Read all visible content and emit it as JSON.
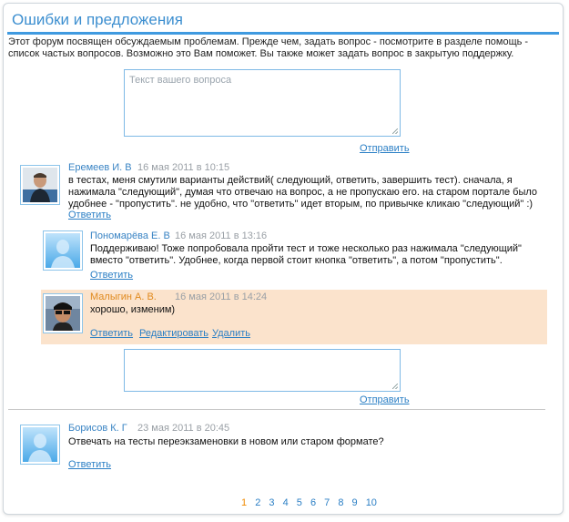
{
  "header": {
    "title": "Ошибки и предложения"
  },
  "intro": "Этот форум посвящен обсуждаемым проблемам. Прежде чем, задать вопрос - посмотрите в разделе помощь - список частых вопросов. Возможно это Вам поможет. Вы также может задать вопрос в закрытую поддержку.",
  "question_box": {
    "placeholder": "Текст вашего вопроса",
    "send_label": "Отправить"
  },
  "threads": [
    {
      "author": "Еремеев И. В",
      "date": "16 мая 2011 в 10:15",
      "text": "в тестах, меня смутили варианты действий( следующий, ответить, завершить тест). сначала, я нажимала \"следующий\", думая что отвечаю на вопрос, а не пропускаю его. на старом портале было удобнее - \"пропустить\". не удобно, что \"ответить\" идет вторым, по привычке кликаю \"следующий\" :)",
      "reply_label": "Ответить",
      "replies": [
        {
          "author": "Пономарёва Е. В",
          "date": "16 мая 2011 в 13:16",
          "text": "Поддерживаю! Тоже попробовала пройти тест и тоже несколько раз нажимала \"следующий\" вместо \"ответить\". Удобнее, когда первой стоит кнопка \"ответить\", а потом \"пропустить\".",
          "reply_label": "Ответить"
        },
        {
          "author": "Малыгин А. В.",
          "date": "16 мая 2011 в 14:24",
          "text": "хорошо, изменим)",
          "reply_label": "Ответить",
          "edit_label": "Редактировать",
          "delete_label": "Удалить"
        }
      ],
      "reply_box": {
        "placeholder": "",
        "send_label": "Отправить"
      }
    },
    {
      "author": "Борисов К. Г",
      "date": "23 мая 2011 в 20:45",
      "text": "Отвечать на тесты переэкзаменовки в новом или старом формате?",
      "reply_label": "Ответить"
    }
  ],
  "pagination": {
    "current": "1",
    "pages": [
      "2",
      "3",
      "4",
      "5",
      "6",
      "7",
      "8",
      "9",
      "10"
    ]
  },
  "colors": {
    "accent": "#3f9ae0",
    "link": "#2b7fc5",
    "highlight": "#fbe3cc",
    "own_author": "#e08a1e"
  }
}
